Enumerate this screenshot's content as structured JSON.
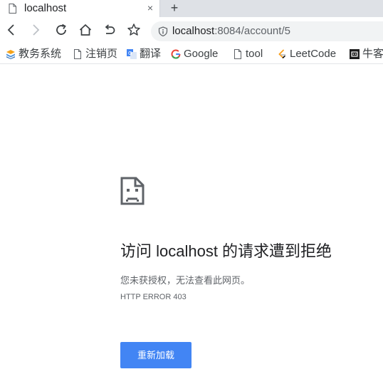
{
  "tab": {
    "title": "localhost",
    "close_glyph": "×",
    "new_tab_glyph": "+",
    "favicon": "page-icon"
  },
  "toolbar": {
    "back": "chevron-left-icon",
    "forward": "chevron-right-icon",
    "reload": "reload-icon",
    "home": "home-icon",
    "undo": "undo-icon",
    "star": "star-icon"
  },
  "omnibox": {
    "host": "localhost",
    "rest": ":8084/account/5",
    "security_icon": "info-icon"
  },
  "bookmarks": [
    {
      "label": "教务系统",
      "icon": "edu-icon"
    },
    {
      "label": "注销页",
      "icon": "page-icon"
    },
    {
      "label": "翻译",
      "icon": "translate-icon"
    },
    {
      "label": "Google",
      "icon": "google-icon"
    },
    {
      "label": "tool",
      "icon": "page-icon"
    },
    {
      "label": "LeetCode",
      "icon": "leetcode-icon"
    },
    {
      "label": "牛客",
      "icon": "nowcoder-icon"
    }
  ],
  "error": {
    "icon": "sad-page-icon",
    "title": "访问 localhost 的请求遭到拒绝",
    "description": "您未获授权，无法查看此网页。",
    "code": "HTTP ERROR 403",
    "reload_label": "重新加载"
  },
  "colors": {
    "accent": "#4285f4",
    "tab_strip": "#dee1e6",
    "omnibox": "#f1f3f4",
    "secondary_text": "#5f6368"
  }
}
